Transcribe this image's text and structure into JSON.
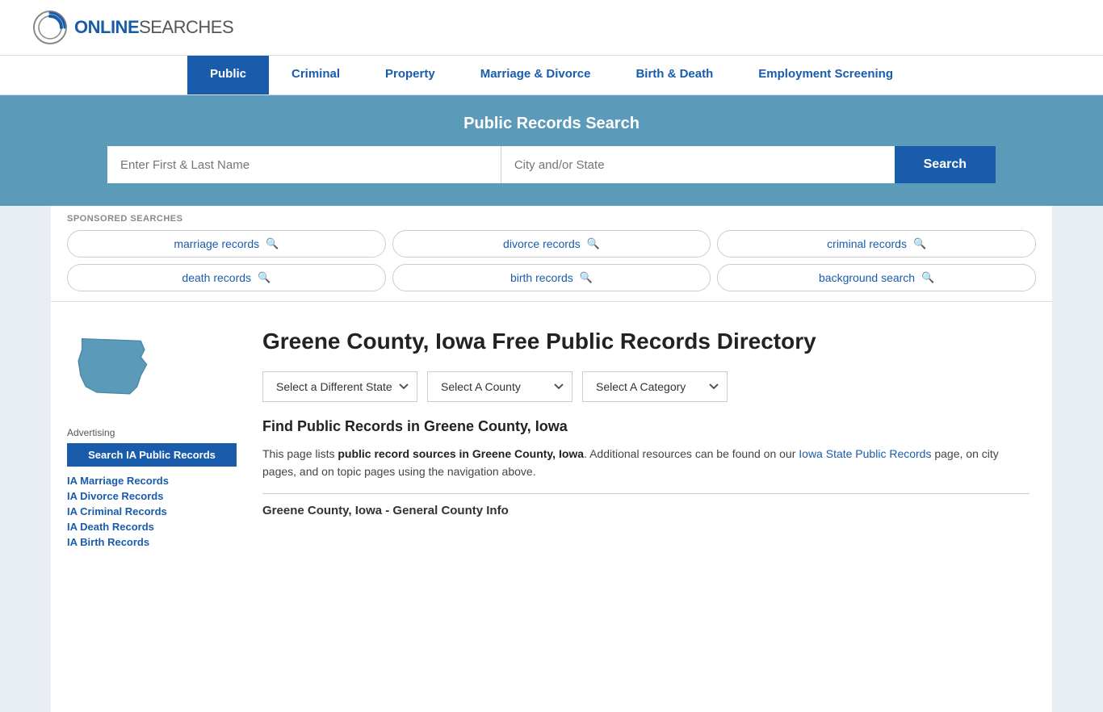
{
  "logo": {
    "online": "ONLINE",
    "searches": "SEARCHES"
  },
  "nav": {
    "items": [
      {
        "label": "Public",
        "active": true
      },
      {
        "label": "Criminal",
        "active": false
      },
      {
        "label": "Property",
        "active": false
      },
      {
        "label": "Marriage & Divorce",
        "active": false
      },
      {
        "label": "Birth & Death",
        "active": false
      },
      {
        "label": "Employment Screening",
        "active": false
      }
    ]
  },
  "search_banner": {
    "title": "Public Records Search",
    "name_placeholder": "Enter First & Last Name",
    "location_placeholder": "City and/or State",
    "search_label": "Search"
  },
  "sponsored": {
    "label": "SPONSORED SEARCHES",
    "items": [
      {
        "label": "marriage records"
      },
      {
        "label": "divorce records"
      },
      {
        "label": "criminal records"
      },
      {
        "label": "death records"
      },
      {
        "label": "birth records"
      },
      {
        "label": "background search"
      }
    ]
  },
  "sidebar": {
    "advertising_label": "Advertising",
    "ad_search_label": "Search IA Public Records",
    "links": [
      {
        "label": "IA Marriage Records"
      },
      {
        "label": "IA Divorce Records"
      },
      {
        "label": "IA Criminal Records"
      },
      {
        "label": "IA Death Records"
      },
      {
        "label": "IA Birth Records"
      }
    ]
  },
  "content": {
    "page_title": "Greene County, Iowa Free Public Records Directory",
    "dropdowns": {
      "state_placeholder": "Select a Different State",
      "county_placeholder": "Select A County",
      "category_placeholder": "Select A Category"
    },
    "find_title": "Find Public Records in Greene County, Iowa",
    "find_text_start": "This page lists ",
    "find_text_bold": "public record sources in Greene County, Iowa",
    "find_text_mid": ". Additional resources can be found on our ",
    "find_link": "Iowa State Public Records",
    "find_text_end": " page, on city pages, and on topic pages using the navigation above.",
    "general_county_title": "Greene County, Iowa - General County Info"
  }
}
